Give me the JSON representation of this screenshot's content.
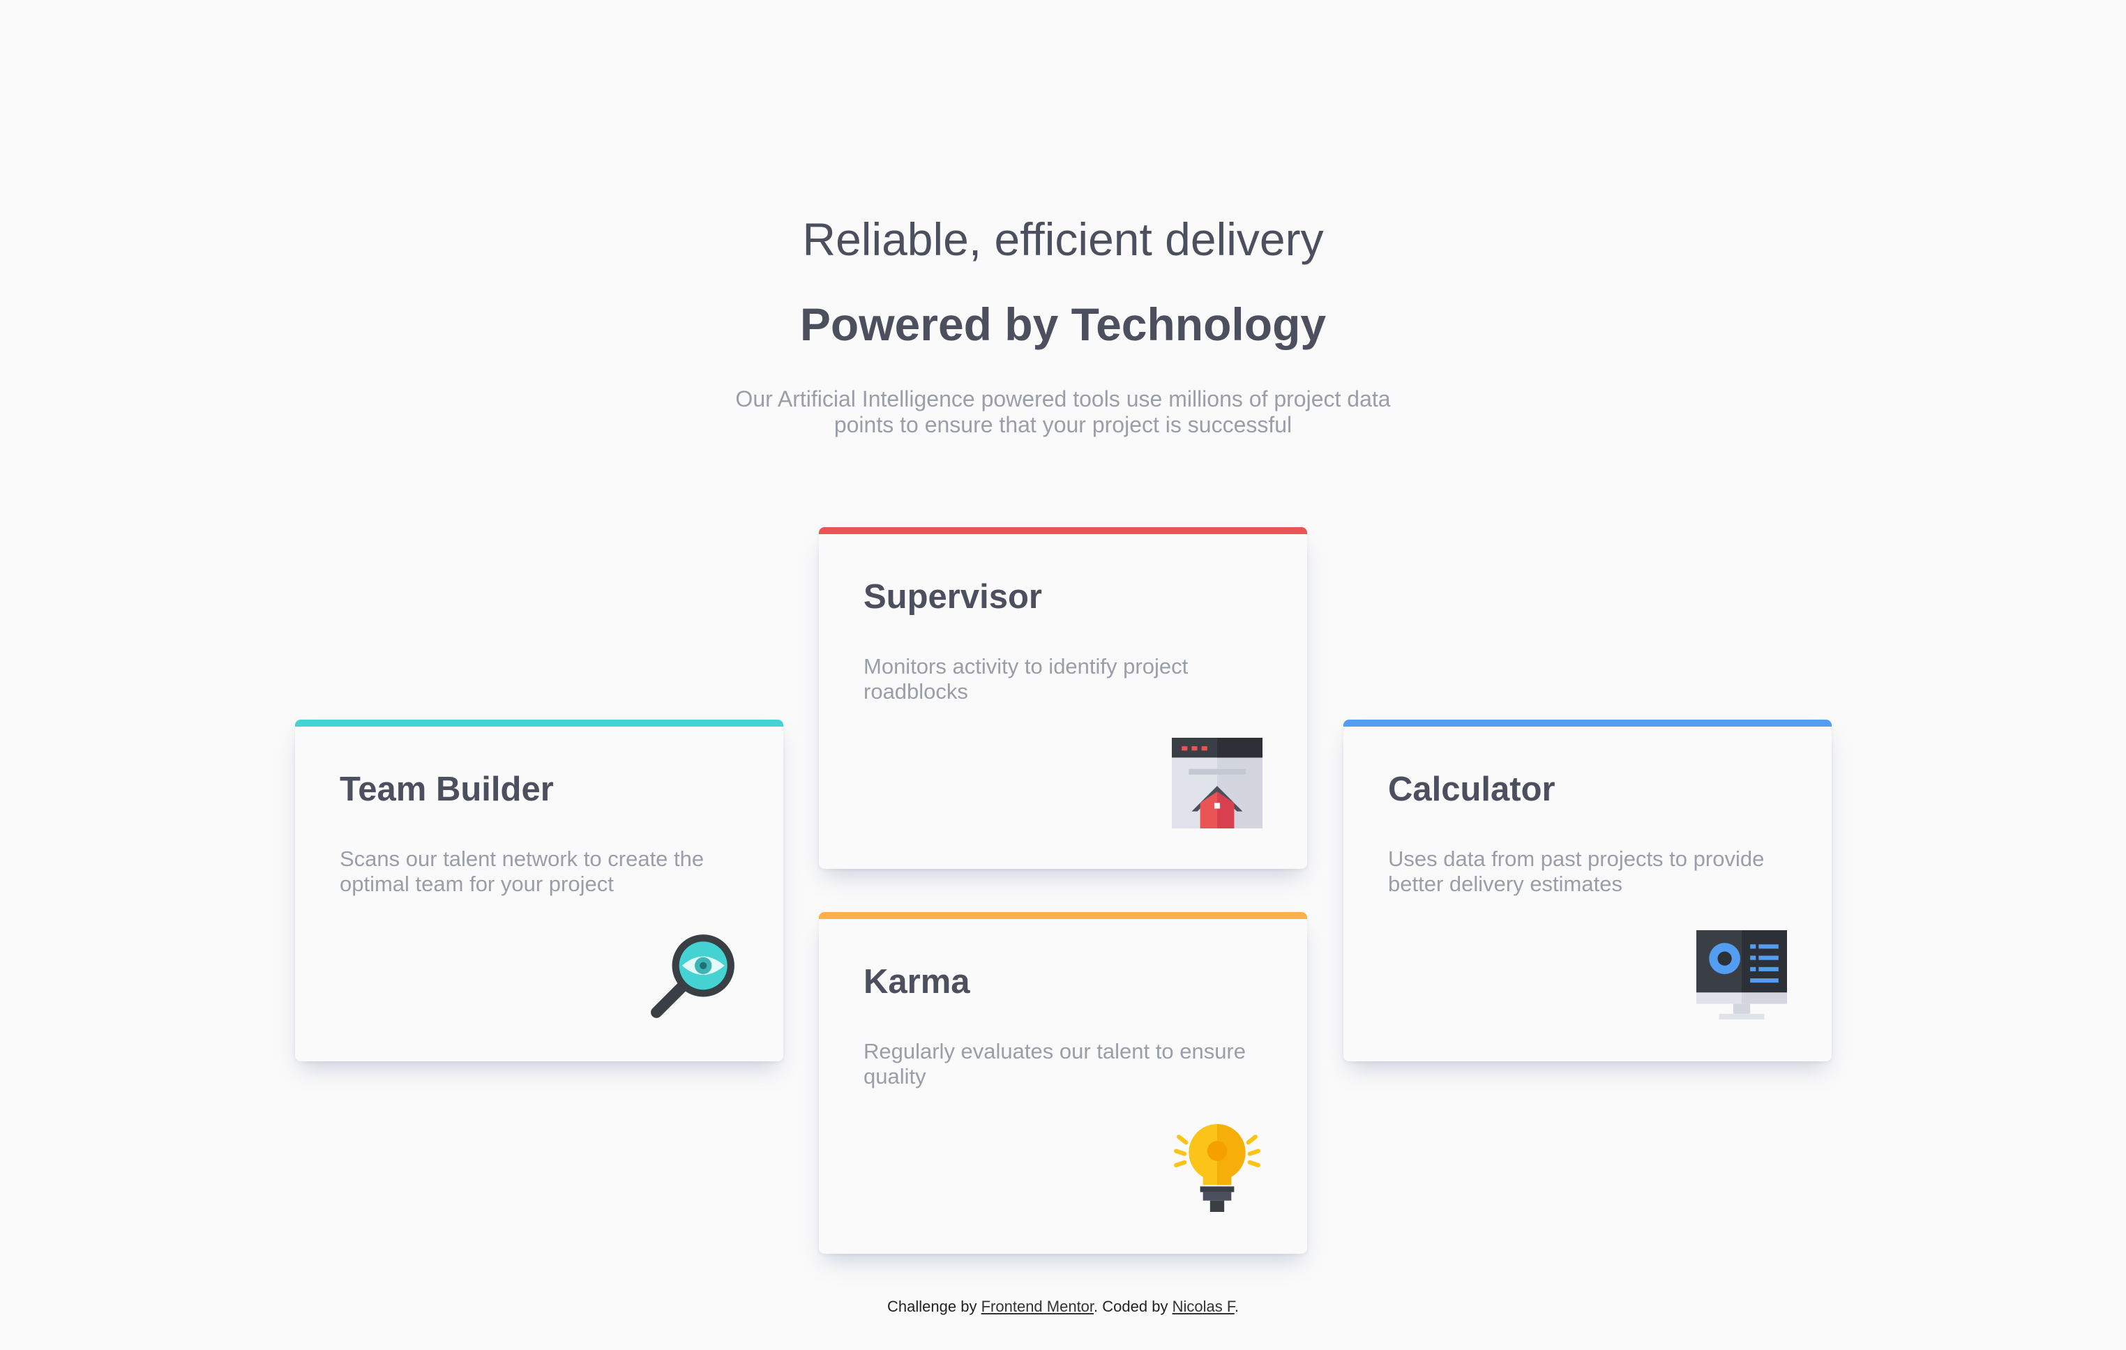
{
  "header": {
    "subtitle": "Reliable, efficient delivery",
    "title": "Powered by Technology",
    "intro": "Our Artificial Intelligence powered tools use millions of project data points to ensure that your project is successful"
  },
  "cards": [
    {
      "title": "Supervisor",
      "description": "Monitors activity to identify project roadblocks",
      "icon": "supervisor-icon",
      "accent": "#ea5454"
    },
    {
      "title": "Team Builder",
      "description": "Scans our talent network to create the optimal team for your project",
      "icon": "team-builder-icon",
      "accent": "#44d3d2"
    },
    {
      "title": "Karma",
      "description": "Regularly evaluates our talent to ensure quality",
      "icon": "karma-icon",
      "accent": "#fcaf4a"
    },
    {
      "title": "Calculator",
      "description": "Uses data from past projects to provide better delivery estimates",
      "icon": "calculator-icon",
      "accent": "#549ef2"
    }
  ],
  "footer": {
    "prefix": "Challenge by",
    "link1": "Frontend Mentor",
    "middle": ". Coded by",
    "link2": "Nicolas F",
    "suffix": "."
  }
}
